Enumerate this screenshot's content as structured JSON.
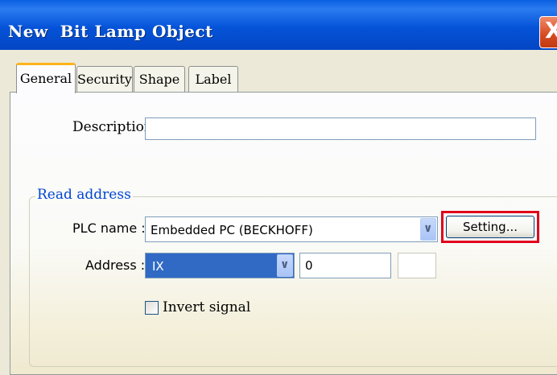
{
  "window": {
    "title": "New  Bit Lamp Object",
    "close_glyph": "X"
  },
  "tabs": [
    {
      "label": "General",
      "active": true
    },
    {
      "label": "Security",
      "active": false
    },
    {
      "label": "Shape",
      "active": false
    },
    {
      "label": "Label",
      "active": false
    }
  ],
  "general": {
    "description": {
      "label": "Description :",
      "value": ""
    },
    "read_address": {
      "legend": "Read address",
      "plc_name": {
        "label": "PLC name :",
        "value": "Embedded PC (BECKHOFF)"
      },
      "setting_button": "Setting...",
      "address": {
        "label": "Address :",
        "device_type": "IX",
        "value": "0",
        "extra": ""
      },
      "invert_signal": {
        "label": "Invert signal",
        "checked": false
      }
    }
  },
  "colors": {
    "titlebar": "#0553d8",
    "group_legend": "#0046d5",
    "highlight_box": "#e0001a",
    "selected_combo": "#316ac5",
    "active_tab_accent": "#ffb21b"
  },
  "icons": {
    "close": "close-icon",
    "dropdown": "chevron-down-icon",
    "checkbox": "checkbox-unchecked-icon"
  }
}
